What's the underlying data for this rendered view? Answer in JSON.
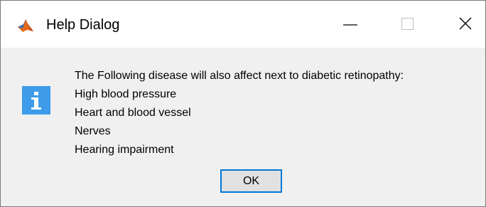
{
  "window": {
    "title": "Help Dialog",
    "icon": "matlab-icon",
    "controls": {
      "minimize": "minimize-icon",
      "maximize": "maximize-icon",
      "close": "close-icon"
    }
  },
  "dialog": {
    "icon": "info-icon",
    "icon_color": "#3d9be9",
    "message_lines": [
      "The Following disease will also affect next to diabetic retinopathy:",
      "High blood pressure",
      "Heart and blood vessel",
      "Nerves",
      "Hearing impairment"
    ],
    "ok_label": "OK",
    "ok_border_color": "#0078d7"
  }
}
